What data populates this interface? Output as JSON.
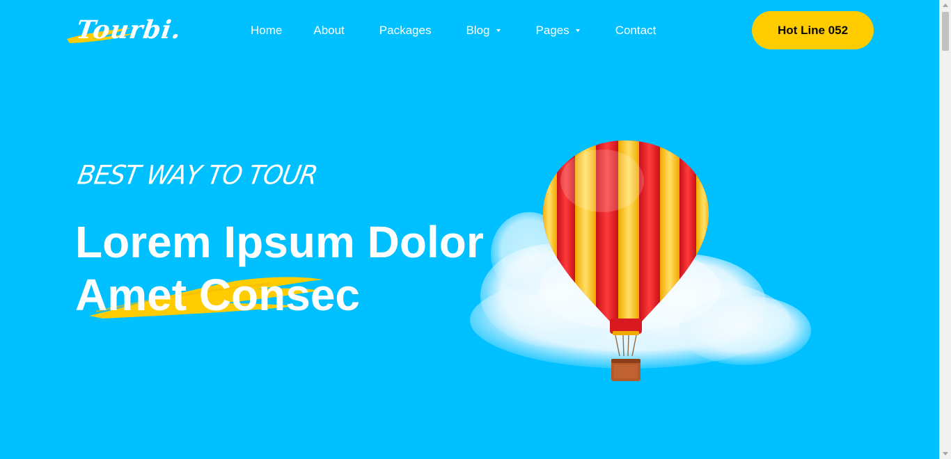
{
  "brand": {
    "logo_text": "Tourbi.",
    "accent_color": "#ffcc00",
    "background_color": "#00c0ff"
  },
  "nav": {
    "items": [
      {
        "label": "Home",
        "has_dropdown": false
      },
      {
        "label": "About",
        "has_dropdown": false
      },
      {
        "label": "Packages",
        "has_dropdown": false
      },
      {
        "label": "Blog",
        "has_dropdown": true
      },
      {
        "label": "Pages",
        "has_dropdown": true
      },
      {
        "label": "Contact",
        "has_dropdown": false
      }
    ]
  },
  "header": {
    "cta_label": "Hot Line 052"
  },
  "hero": {
    "tagline": "BEST WAY TO TOUR",
    "headline_line1": "Lorem Ipsum Dolor",
    "headline_line2": "Amet Consec",
    "illustration_icon": "hot-air-balloon-icon"
  }
}
